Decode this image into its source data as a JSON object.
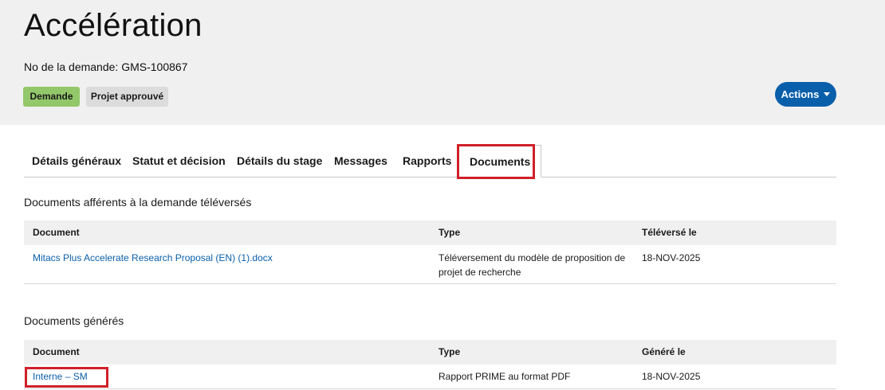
{
  "header": {
    "title": "Accélération",
    "request_no": "No de la demande: GMS-100867",
    "badges": [
      "Demande",
      "Projet approuvé"
    ],
    "actions_label": "Actions"
  },
  "tabs": [
    {
      "label": "Détails généraux"
    },
    {
      "label": "Statut et décision"
    },
    {
      "label": "Détails du stage"
    },
    {
      "label": "Messages"
    },
    {
      "label": "Rapports"
    },
    {
      "label": "Documents",
      "active": true
    }
  ],
  "uploaded": {
    "title": "Documents afférents à la demande téléversés",
    "columns": [
      "Document",
      "Type",
      "Téléversé le"
    ],
    "rows": [
      {
        "document": "Mitacs Plus Accelerate Research Proposal (EN) (1).docx",
        "type_line1": "Téléversement du modèle de proposition de",
        "type_line2": "projet de recherche",
        "date": "18-NOV-2025"
      }
    ]
  },
  "generated": {
    "title": "Documents générés",
    "columns": [
      "Document",
      "Type",
      "Généré le"
    ],
    "rows": [
      {
        "document": "Interne – SM",
        "type": "Rapport PRIME au format PDF",
        "date": "18-NOV-2025"
      }
    ]
  },
  "colors": {
    "header_bg": "#f0f0f0",
    "accent_blue": "#0a5fab",
    "badge_green": "#93c86a",
    "badge_gray": "#dcdcdc",
    "highlight_red": "#d0202a"
  }
}
